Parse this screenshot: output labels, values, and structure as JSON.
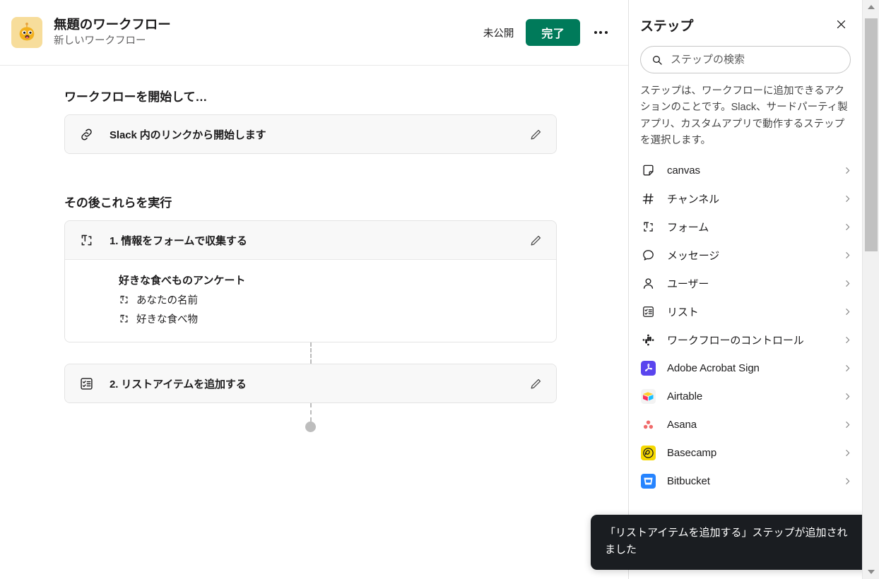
{
  "header": {
    "icon": "robot-emoji",
    "title": "無題のワークフロー",
    "subtitle": "新しいワークフロー",
    "status_label": "未公開",
    "done_label": "完了",
    "more_label": "overflow-menu"
  },
  "canvas": {
    "trigger_section_title": "ワークフローを開始して…",
    "trigger": {
      "icon": "link-icon",
      "label": "Slack 内のリンクから開始します",
      "edit_label": "編集"
    },
    "steps_section_title": "その後これらを実行",
    "steps": [
      {
        "icon": "form-icon",
        "label": "1. 情報をフォームで収集する",
        "edit_label": "編集",
        "detail": {
          "title": "好きな食べものアンケート",
          "fields": [
            {
              "icon": "form-field-icon",
              "label": "あなたの名前"
            },
            {
              "icon": "form-field-icon",
              "label": "好きな食べ物"
            }
          ]
        }
      },
      {
        "icon": "list-icon",
        "label": "2. リストアイテムを追加する",
        "edit_label": "編集",
        "detail": null
      }
    ]
  },
  "panel": {
    "title": "ステップ",
    "close_label": "閉じる",
    "search": {
      "icon": "search-icon",
      "placeholder": "ステップの検索",
      "value": ""
    },
    "description": "ステップは、ワークフローに追加できるアクションのことです。Slack、サードパーティ製アプリ、カスタムアプリで動作するステップを選択します。",
    "items": [
      {
        "icon": "canvas-icon",
        "label": "canvas",
        "type": "slack"
      },
      {
        "icon": "hash-icon",
        "label": "チャンネル",
        "type": "slack"
      },
      {
        "icon": "form-icon",
        "label": "フォーム",
        "type": "slack"
      },
      {
        "icon": "message-icon",
        "label": "メッセージ",
        "type": "slack"
      },
      {
        "icon": "user-icon",
        "label": "ユーザー",
        "type": "slack"
      },
      {
        "icon": "list-icon",
        "label": "リスト",
        "type": "slack"
      },
      {
        "icon": "slack-icon",
        "label": "ワークフローのコントロール",
        "type": "slack"
      },
      {
        "icon": "adobe-acrobat-sign-icon",
        "label": "Adobe Acrobat Sign",
        "type": "app",
        "color": "#5a45ee"
      },
      {
        "icon": "airtable-icon",
        "label": "Airtable",
        "type": "app",
        "color": "#f5f5f5"
      },
      {
        "icon": "asana-icon",
        "label": "Asana",
        "type": "app",
        "color": "#ffffff"
      },
      {
        "icon": "basecamp-icon",
        "label": "Basecamp",
        "type": "app",
        "color": "#f5d800"
      },
      {
        "icon": "bitbucket-icon",
        "label": "Bitbucket",
        "type": "app",
        "color": "#2684ff"
      }
    ]
  },
  "toast": {
    "message": "「リストアイテムを追加する」ステップが追加されました"
  },
  "scrollbar": {
    "up_label": "上にスクロール",
    "down_label": "下にスクロール",
    "thumb_label": "スクロールバー"
  },
  "colors": {
    "brand_green": "#007a5a",
    "icon_bg": "#f7dd9b",
    "card_bg": "#f8f8f8",
    "toast_bg": "#1a1d21"
  }
}
